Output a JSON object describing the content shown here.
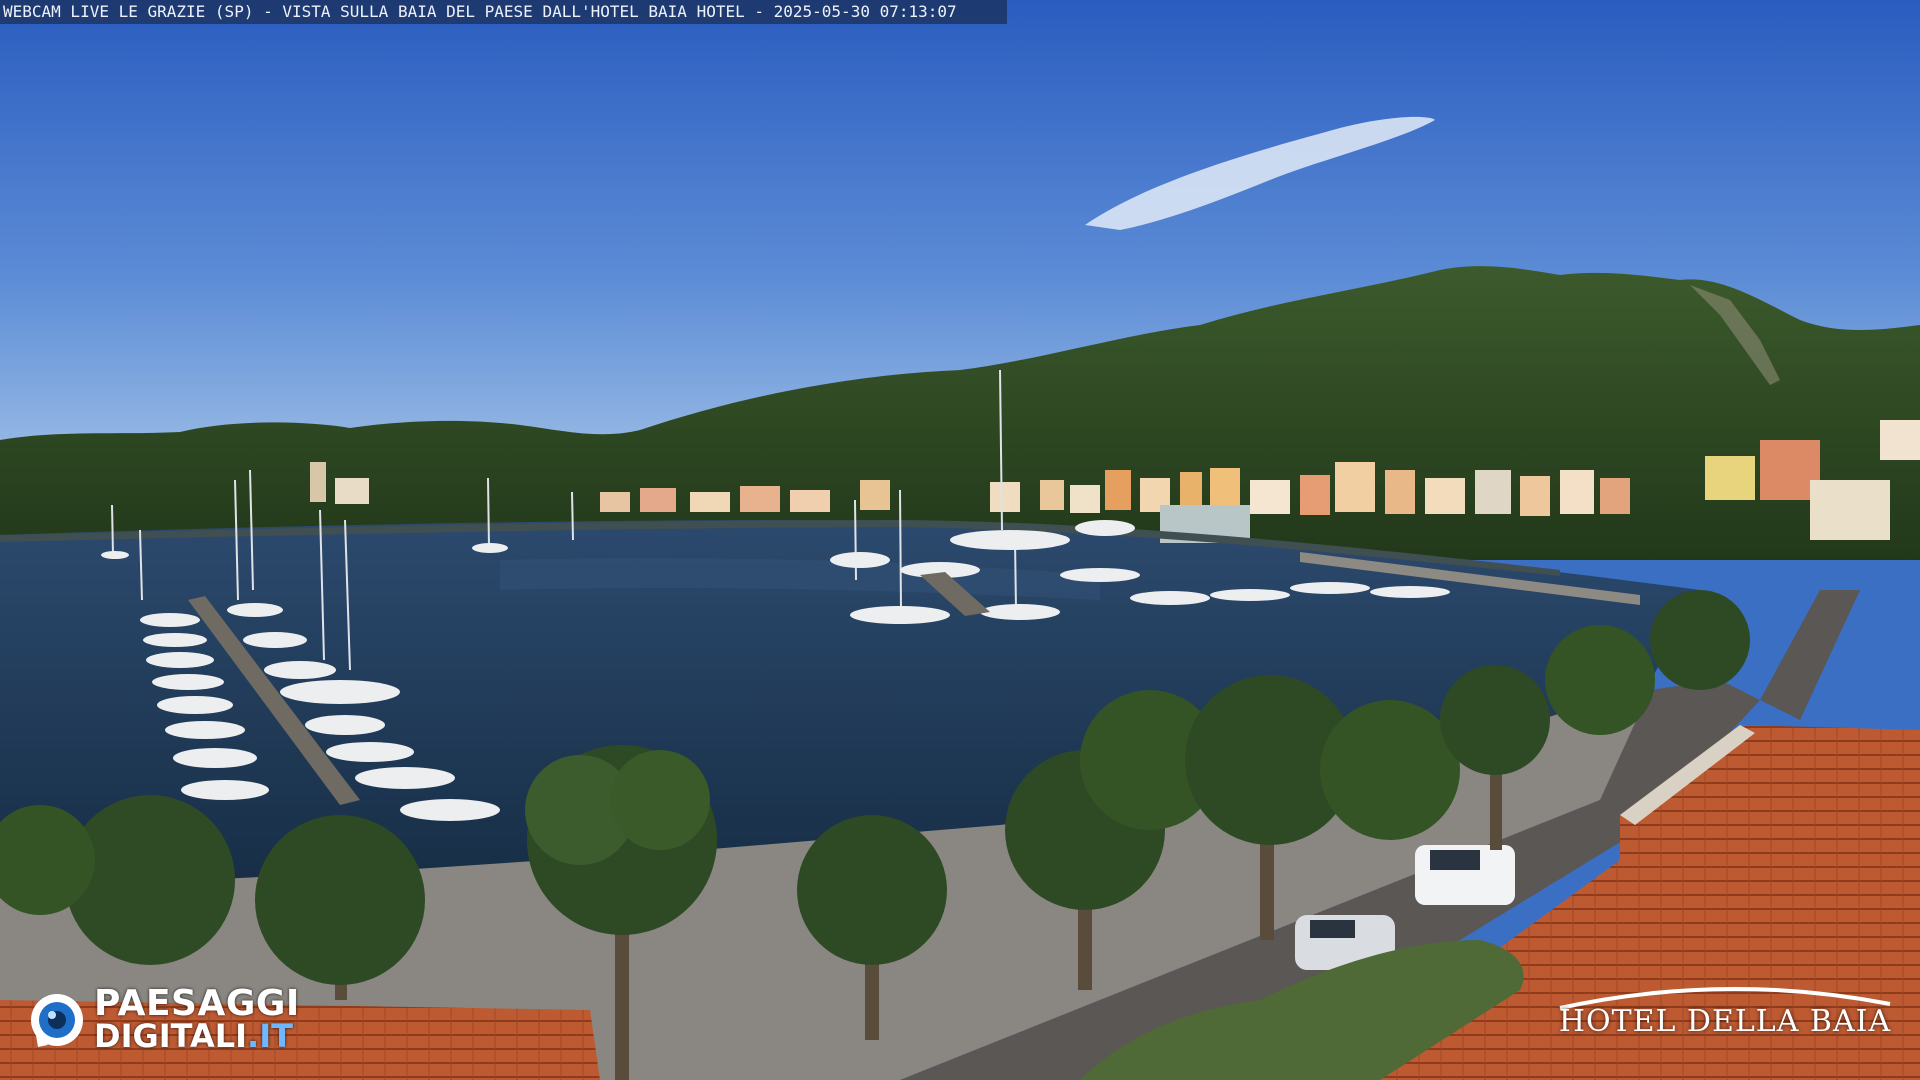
{
  "webcam": {
    "overlay_title": "WEBCAM LIVE LE GRAZIE (SP) - VISTA SULLA BAIA DEL PAESE DALL'HOTEL BAIA HOTEL - 2025-05-30 07:13:07"
  },
  "brand_logo": {
    "line1": "PAESAGGI",
    "line2": "DIGITALI",
    "tld": ".IT"
  },
  "hotel_logo": {
    "name": "HOTEL DELLA BAIA"
  },
  "colors": {
    "sky_top": "#2f63c3",
    "sky_bottom": "#8fb3e0",
    "water": "#1e3a5a",
    "hills": "#2f4a22",
    "roof": "#b8552e",
    "promenade": "#8d8a84"
  }
}
